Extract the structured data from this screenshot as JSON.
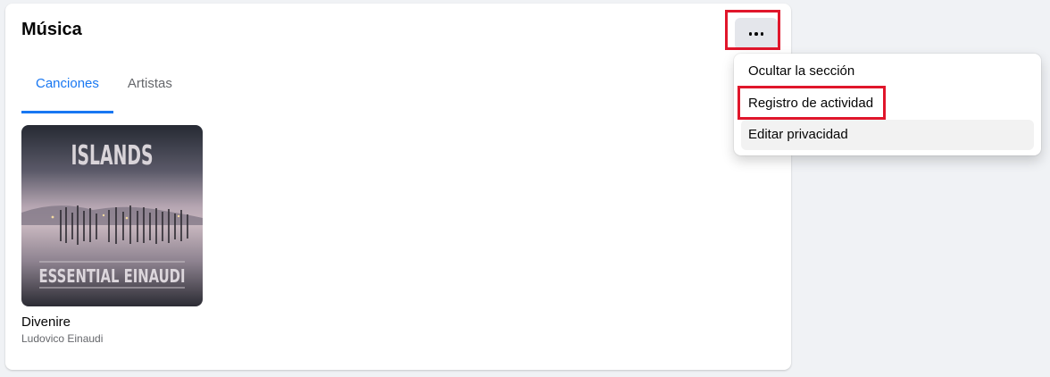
{
  "section": {
    "title": "Música",
    "tabs": [
      {
        "label": "Canciones",
        "active": true
      },
      {
        "label": "Artistas",
        "active": false
      }
    ]
  },
  "more_button": {
    "icon": "more-horizontal-icon"
  },
  "menu": {
    "items": [
      {
        "label": "Ocultar la sección"
      },
      {
        "label": "Registro de actividad"
      },
      {
        "label": "Editar privacidad"
      }
    ]
  },
  "songs": [
    {
      "title": "Divenire",
      "artist": "Ludovico Einaudi",
      "cover_top_text": "ISLANDS",
      "cover_bottom_text": "ESSENTIAL EINAUDI"
    }
  ],
  "colors": {
    "accent": "#1877f2",
    "highlight": "#e0162b",
    "background": "#f0f2f5"
  }
}
